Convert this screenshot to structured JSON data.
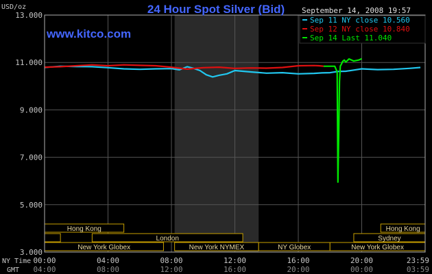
{
  "chart_data": {
    "type": "line",
    "title": "24 Hour Spot Silver (Bid)",
    "ylabel": "USD/oz",
    "ylim": [
      3.0,
      13.0
    ],
    "y_ticks": [
      "3.000",
      "5.000",
      "7.000",
      "9.000",
      "11.000",
      "13.000"
    ],
    "x_hours": [
      0,
      4,
      8,
      12,
      16,
      20,
      24
    ],
    "x_ticks_ny": [
      "00:00",
      "04:00",
      "08:00",
      "12:00",
      "16:00",
      "20:00",
      "23:59"
    ],
    "x_ticks_gmt": [
      "04:00",
      "08:00",
      "12:00",
      "16:00",
      "20:00",
      "00:00",
      "03:59"
    ],
    "x_row_labels": {
      "ny": "NY Time",
      "gmt": "GMT"
    },
    "grid": true,
    "legend_position": "top-right",
    "series": [
      {
        "name": "Sep 11 NY close 10.560",
        "color": "#22c8f0",
        "x": [
          0,
          1,
          2,
          3,
          4,
          5,
          6,
          7,
          8,
          8.5,
          9,
          9.4,
          9.8,
          10.2,
          10.6,
          11,
          11.5,
          12,
          13,
          14,
          15,
          16,
          17,
          17.5,
          18,
          18.5,
          19,
          19.5,
          20,
          21,
          22,
          23,
          23.7
        ],
        "values": [
          10.79,
          10.84,
          10.83,
          10.82,
          10.78,
          10.73,
          10.71,
          10.73,
          10.74,
          10.69,
          10.82,
          10.75,
          10.66,
          10.48,
          10.39,
          10.46,
          10.52,
          10.66,
          10.6,
          10.55,
          10.57,
          10.52,
          10.54,
          10.56,
          10.57,
          10.62,
          10.63,
          10.68,
          10.73,
          10.7,
          10.71,
          10.75,
          10.79
        ]
      },
      {
        "name": "Sep 12 NY close 10.840",
        "color": "#e01010",
        "x": [
          0,
          1,
          2,
          3,
          4,
          5,
          6,
          7,
          8,
          9,
          10,
          11,
          12,
          13,
          14,
          15,
          16,
          17,
          17.3,
          17.6
        ],
        "values": [
          10.8,
          10.82,
          10.86,
          10.9,
          10.86,
          10.9,
          10.88,
          10.86,
          10.8,
          10.72,
          10.78,
          10.8,
          10.75,
          10.77,
          10.76,
          10.79,
          10.86,
          10.87,
          10.86,
          10.84
        ]
      },
      {
        "name": "Sep 14 Last 11.040",
        "color": "#00e800",
        "x": [
          17.6,
          18.3,
          18.45,
          18.5,
          18.55,
          18.6,
          18.65,
          18.7,
          18.8,
          18.9,
          19.0,
          19.2,
          19.5,
          19.8,
          20.0
        ],
        "values": [
          10.84,
          10.84,
          10.6,
          5.95,
          8.0,
          10.2,
          10.85,
          10.9,
          11.05,
          11.1,
          11.02,
          11.15,
          11.06,
          11.1,
          11.16
        ]
      }
    ],
    "sessions": [
      {
        "label": "Hong Kong",
        "row": 1,
        "start": 0,
        "end": 5
      },
      {
        "label": "",
        "row": 2,
        "start": 0,
        "end": 1
      },
      {
        "label": "London",
        "row": 2,
        "start": 3,
        "end": 12.5
      },
      {
        "label": "New York Globex",
        "row": 3,
        "start": 0,
        "end": 7.5
      },
      {
        "label": "New York NYMEX",
        "row": 3,
        "start": 8.2,
        "end": 13.5
      },
      {
        "label": "NY Globex",
        "row": 3,
        "start": 13.5,
        "end": 18
      },
      {
        "label": "Hong Kong",
        "row": 1,
        "start": 21.2,
        "end": 24
      },
      {
        "label": "Sydney",
        "row": 2,
        "start": 19.5,
        "end": 24
      },
      {
        "label": "New York Globex",
        "row": 3,
        "start": 18,
        "end": 24
      }
    ]
  },
  "header": {
    "date_time": "September 14, 2008 19:57",
    "watermark": "www.kitco.com"
  },
  "colors": {
    "background": "#000000",
    "plot_frame": "#b0b0b0",
    "grid": "#555555",
    "shade": "#2a2a2a",
    "title": "#4466ff",
    "text": "#c8c8c8",
    "session_box": "#c8a000",
    "session_text": "#e8d8a0"
  }
}
